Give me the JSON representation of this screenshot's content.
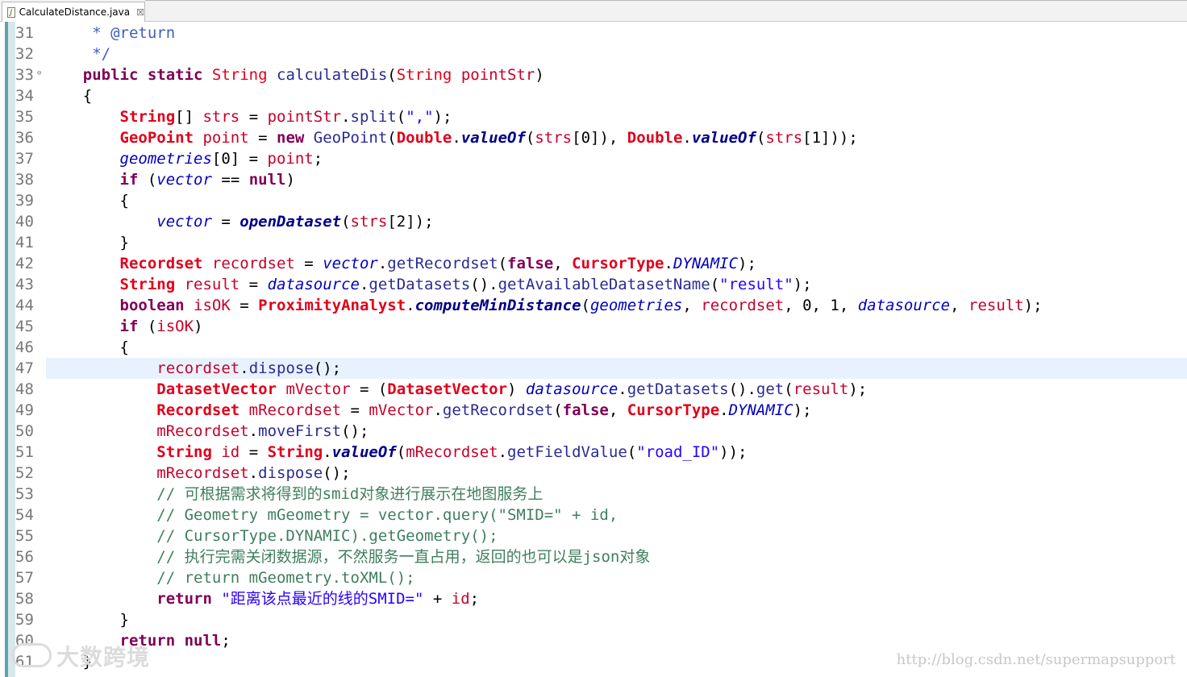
{
  "tab": {
    "title": "CalculateDistance.java",
    "close_glyph": "☒"
  },
  "editor": {
    "highlight_line": "47",
    "lines": [
      {
        "n": "31",
        "t": [
          [
            "jd",
            "     * @return"
          ]
        ]
      },
      {
        "n": "32",
        "t": [
          [
            "jd",
            "     */"
          ]
        ]
      },
      {
        "n": "33",
        "fold": true,
        "t": [
          [
            "",
            "    "
          ],
          [
            "kw",
            "public static "
          ],
          [
            "ty",
            "String "
          ],
          [
            "mth",
            "calculateDis"
          ],
          [
            "",
            "("
          ],
          [
            "ty",
            "String "
          ],
          [
            "var",
            "pointStr"
          ],
          [
            "",
            ")"
          ]
        ]
      },
      {
        "n": "34",
        "t": [
          [
            "",
            "    {"
          ]
        ]
      },
      {
        "n": "35",
        "t": [
          [
            "",
            "        "
          ],
          [
            "tyb",
            "String"
          ],
          [
            "",
            "[] "
          ],
          [
            "var",
            "strs"
          ],
          [
            "",
            " = "
          ],
          [
            "var",
            "pointStr"
          ],
          [
            "",
            "."
          ],
          [
            "mth",
            "split"
          ],
          [
            "",
            "("
          ],
          [
            "str",
            "\",\""
          ],
          [
            "",
            ");"
          ]
        ]
      },
      {
        "n": "36",
        "t": [
          [
            "",
            "        "
          ],
          [
            "tyb",
            "GeoPoint "
          ],
          [
            "var",
            "point"
          ],
          [
            "",
            " = "
          ],
          [
            "kw",
            "new "
          ],
          [
            "mth",
            "GeoPoint"
          ],
          [
            "",
            "("
          ],
          [
            "tyb",
            "Double"
          ],
          [
            "",
            "."
          ],
          [
            "smth",
            "valueOf"
          ],
          [
            "",
            "("
          ],
          [
            "var",
            "strs"
          ],
          [
            "",
            "[0]), "
          ],
          [
            "tyb",
            "Double"
          ],
          [
            "",
            "."
          ],
          [
            "smth",
            "valueOf"
          ],
          [
            "",
            "("
          ],
          [
            "var",
            "strs"
          ],
          [
            "",
            "[1]));"
          ]
        ]
      },
      {
        "n": "37",
        "t": [
          [
            "",
            "        "
          ],
          [
            "fld",
            "geometries"
          ],
          [
            "",
            "[0] = "
          ],
          [
            "var",
            "point"
          ],
          [
            "",
            ";"
          ]
        ]
      },
      {
        "n": "38",
        "t": [
          [
            "",
            "        "
          ],
          [
            "kw",
            "if "
          ],
          [
            "",
            "("
          ],
          [
            "fld",
            "vector"
          ],
          [
            "",
            " == "
          ],
          [
            "kw",
            "null"
          ],
          [
            "",
            ")"
          ]
        ]
      },
      {
        "n": "39",
        "t": [
          [
            "",
            "        {"
          ]
        ]
      },
      {
        "n": "40",
        "t": [
          [
            "",
            "            "
          ],
          [
            "fld",
            "vector"
          ],
          [
            "",
            " = "
          ],
          [
            "smth",
            "openDataset"
          ],
          [
            "",
            "("
          ],
          [
            "var",
            "strs"
          ],
          [
            "",
            "[2]);"
          ]
        ]
      },
      {
        "n": "41",
        "t": [
          [
            "",
            "        }"
          ]
        ]
      },
      {
        "n": "42",
        "t": [
          [
            "",
            "        "
          ],
          [
            "tyb",
            "Recordset "
          ],
          [
            "var",
            "recordset"
          ],
          [
            "",
            " = "
          ],
          [
            "fld",
            "vector"
          ],
          [
            "",
            "."
          ],
          [
            "mth",
            "getRecordset"
          ],
          [
            "",
            "("
          ],
          [
            "kw",
            "false"
          ],
          [
            "",
            ", "
          ],
          [
            "tyb",
            "CursorType"
          ],
          [
            "",
            "."
          ],
          [
            "cst",
            "DYNAMIC"
          ],
          [
            "",
            ");"
          ]
        ]
      },
      {
        "n": "43",
        "t": [
          [
            "",
            "        "
          ],
          [
            "tyb",
            "String "
          ],
          [
            "var",
            "result"
          ],
          [
            "",
            " = "
          ],
          [
            "fld",
            "datasource"
          ],
          [
            "",
            "."
          ],
          [
            "mth",
            "getDatasets"
          ],
          [
            "",
            "()."
          ],
          [
            "mth",
            "getAvailableDatasetName"
          ],
          [
            "",
            "("
          ],
          [
            "str",
            "\"result\""
          ],
          [
            "",
            ");"
          ]
        ]
      },
      {
        "n": "44",
        "t": [
          [
            "",
            "        "
          ],
          [
            "kw",
            "boolean "
          ],
          [
            "var",
            "isOK"
          ],
          [
            "",
            " = "
          ],
          [
            "tyb",
            "ProximityAnalyst"
          ],
          [
            "",
            "."
          ],
          [
            "smth",
            "computeMinDistance"
          ],
          [
            "",
            "("
          ],
          [
            "fld",
            "geometries"
          ],
          [
            "",
            ", "
          ],
          [
            "var",
            "recordset"
          ],
          [
            "",
            ", 0, 1, "
          ],
          [
            "fld",
            "datasource"
          ],
          [
            "",
            ", "
          ],
          [
            "var",
            "result"
          ],
          [
            "",
            ");"
          ]
        ]
      },
      {
        "n": "45",
        "t": [
          [
            "",
            "        "
          ],
          [
            "kw",
            "if "
          ],
          [
            "",
            "("
          ],
          [
            "var",
            "isOK"
          ],
          [
            "",
            ")"
          ]
        ]
      },
      {
        "n": "46",
        "t": [
          [
            "",
            "        {"
          ]
        ]
      },
      {
        "n": "47",
        "t": [
          [
            "",
            "            "
          ],
          [
            "var",
            "recordset"
          ],
          [
            "",
            "."
          ],
          [
            "mth",
            "dispose"
          ],
          [
            "",
            "();"
          ]
        ]
      },
      {
        "n": "48",
        "t": [
          [
            "",
            "            "
          ],
          [
            "tyb",
            "DatasetVector "
          ],
          [
            "var",
            "mVector"
          ],
          [
            "",
            " = ("
          ],
          [
            "tyb",
            "DatasetVector"
          ],
          [
            "",
            ") "
          ],
          [
            "fld",
            "datasource"
          ],
          [
            "",
            "."
          ],
          [
            "mth",
            "getDatasets"
          ],
          [
            "",
            "()."
          ],
          [
            "mth",
            "get"
          ],
          [
            "",
            "("
          ],
          [
            "var",
            "result"
          ],
          [
            "",
            ");"
          ]
        ]
      },
      {
        "n": "49",
        "t": [
          [
            "",
            "            "
          ],
          [
            "tyb",
            "Recordset "
          ],
          [
            "var",
            "mRecordset"
          ],
          [
            "",
            " = "
          ],
          [
            "var",
            "mVector"
          ],
          [
            "",
            "."
          ],
          [
            "mth",
            "getRecordset"
          ],
          [
            "",
            "("
          ],
          [
            "kw",
            "false"
          ],
          [
            "",
            ", "
          ],
          [
            "tyb",
            "CursorType"
          ],
          [
            "",
            "."
          ],
          [
            "cst",
            "DYNAMIC"
          ],
          [
            "",
            ");"
          ]
        ]
      },
      {
        "n": "50",
        "t": [
          [
            "",
            "            "
          ],
          [
            "var",
            "mRecordset"
          ],
          [
            "",
            "."
          ],
          [
            "mth",
            "moveFirst"
          ],
          [
            "",
            "();"
          ]
        ]
      },
      {
        "n": "51",
        "t": [
          [
            "",
            "            "
          ],
          [
            "tyb",
            "String "
          ],
          [
            "var",
            "id"
          ],
          [
            "",
            " = "
          ],
          [
            "tyb",
            "String"
          ],
          [
            "",
            "."
          ],
          [
            "smth",
            "valueOf"
          ],
          [
            "",
            "("
          ],
          [
            "var",
            "mRecordset"
          ],
          [
            "",
            "."
          ],
          [
            "mth",
            "getFieldValue"
          ],
          [
            "",
            "("
          ],
          [
            "str",
            "\"road_ID\""
          ],
          [
            "",
            "));"
          ]
        ]
      },
      {
        "n": "52",
        "t": [
          [
            "",
            "            "
          ],
          [
            "var",
            "mRecordset"
          ],
          [
            "",
            "."
          ],
          [
            "mth",
            "dispose"
          ],
          [
            "",
            "();"
          ]
        ]
      },
      {
        "n": "53",
        "t": [
          [
            "",
            "            "
          ],
          [
            "cmt",
            "// 可根据需求将得到的smid对象进行展示在地图服务上"
          ]
        ]
      },
      {
        "n": "54",
        "t": [
          [
            "",
            "            "
          ],
          [
            "cmt",
            "// Geometry mGeometry = vector.query(\"SMID=\" + id,"
          ]
        ]
      },
      {
        "n": "55",
        "t": [
          [
            "",
            "            "
          ],
          [
            "cmt",
            "// CursorType.DYNAMIC).getGeometry();"
          ]
        ]
      },
      {
        "n": "56",
        "t": [
          [
            "",
            "            "
          ],
          [
            "cmt",
            "// 执行完需关闭数据源，不然服务一直占用，返回的也可以是json对象"
          ]
        ]
      },
      {
        "n": "57",
        "t": [
          [
            "",
            "            "
          ],
          [
            "cmt",
            "// return mGeometry.toXML();"
          ]
        ]
      },
      {
        "n": "58",
        "t": [
          [
            "",
            "            "
          ],
          [
            "kw",
            "return "
          ],
          [
            "str",
            "\"距离该点最近的线的SMID=\""
          ],
          [
            "",
            " + "
          ],
          [
            "var",
            "id"
          ],
          [
            "",
            ";"
          ]
        ]
      },
      {
        "n": "59",
        "t": [
          [
            "",
            "        }"
          ]
        ]
      },
      {
        "n": "60",
        "t": [
          [
            "",
            "        "
          ],
          [
            "kw",
            "return null"
          ],
          [
            "",
            ";"
          ]
        ]
      },
      {
        "n": "61",
        "t": [
          [
            "",
            "    }"
          ]
        ]
      }
    ]
  },
  "watermark": {
    "brand": "大数跨境",
    "url": "http://blog.csdn.net/supermapsupport"
  },
  "colors": {
    "keyword": "#7f0055",
    "type": "#e0001a",
    "string": "#2a00ff",
    "comment": "#3f7f5f",
    "current_line": "#e8f2fe"
  }
}
